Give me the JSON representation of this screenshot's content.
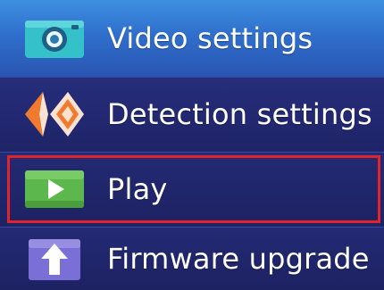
{
  "menu": {
    "items": [
      {
        "label": "Video settings",
        "icon": "camera-icon"
      },
      {
        "label": "Detection settings",
        "icon": "detection-icon"
      },
      {
        "label": "Play",
        "icon": "play-icon",
        "selected": true
      },
      {
        "label": "Firmware upgrade",
        "icon": "upload-arrow-icon"
      }
    ]
  },
  "colors": {
    "highlight_border": "#e0242a",
    "item_background": "#1f2468",
    "active_background": "#3d8fe0",
    "camera_icon": "#35c1c9",
    "detection_icon": "#f07a2e",
    "play_icon": "#5cb84c",
    "upgrade_icon": "#7a6fd6"
  }
}
